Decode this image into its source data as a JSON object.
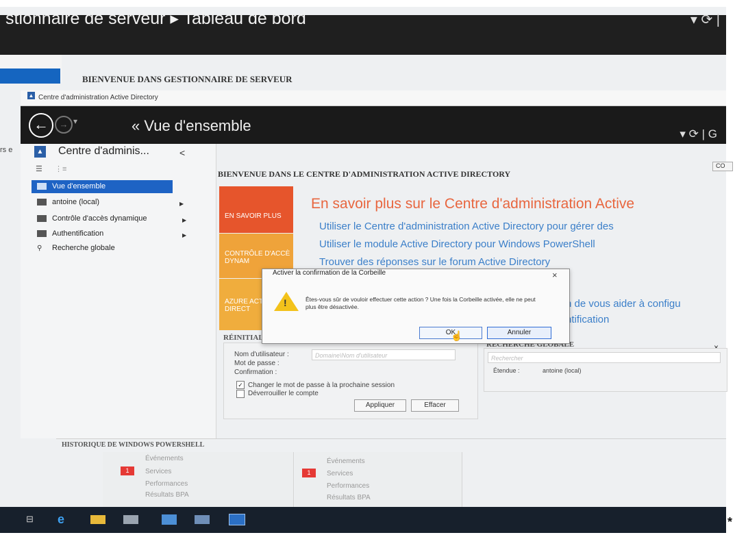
{
  "server_manager": {
    "title": "stionnaire de serveur ▸ Tableau de bord",
    "welcome": "BIENVENUE DANS GESTIONNAIRE DE SERVEUR",
    "refresh_icon": "refresh-icon"
  },
  "adac": {
    "window_title": "Centre d'administration Active Directory",
    "header_title": "« Vue d'ensemble",
    "nav_title": "Centre d'adminis...",
    "nav_collapse": "<",
    "nav_items": [
      {
        "label": "Vue d'ensemble",
        "selected": true
      },
      {
        "label": "antoine (local)",
        "arrow": "▶"
      },
      {
        "label": "Contrôle d'accès dynamique",
        "arrow": "▶"
      },
      {
        "label": "Authentification",
        "arrow": "▶"
      },
      {
        "label": "Recherche globale"
      }
    ],
    "left_fragment": "rs e",
    "main_title": "BIENVENUE DANS LE CENTRE D'ADMINISTRATION ACTIVE DIRECTORY",
    "top_button": "CO",
    "tiles": [
      {
        "label": "EN SAVOIR PLUS"
      },
      {
        "label": "CONTRÔLE D'ACCÈ DYNAM"
      },
      {
        "label": "AZURE ACTIVE DIRECT"
      }
    ],
    "learn": {
      "title": "En savoir plus sur le Centre d'administration Active",
      "links": [
        "Utiliser le Centre d'administration Active Directory pour gérer des",
        "Utiliser le module Active Directory pour Windows PowerShell",
        "Trouver des réponses sur le forum Active Directory"
      ],
      "fragment1": "n de vous aider à configu",
      "fragment2": "ntification"
    },
    "reset": {
      "title": "RÉINITIALISER LE MOT DE PASSE",
      "user_label": "Nom d'utilisateur :",
      "user_placeholder": "Domaine\\Nom d'utilisateur",
      "password_label": "Mot de passe :",
      "confirm_label": "Confirmation :",
      "change_label": "Changer le mot de passe à la prochaine session",
      "unlock_label": "Déverrouiller le compte",
      "apply": "Appliquer",
      "clear": "Effacer"
    },
    "global_search": {
      "title": "RECHERCHE GLOBALE",
      "close": "×",
      "placeholder": "Rechercher",
      "scope_label": "Étendue :",
      "scope_value": "antoine (local)"
    },
    "powershell_title": "HISTORIQUE DE WINDOWS POWERSHELL"
  },
  "dialog": {
    "title": "Activer la confirmation de la Corbeille",
    "close": "×",
    "message": "Êtes-vous sûr de vouloir effectuer cette action ? Une fois la Corbeille activée, elle ne peut plus être désactivée.",
    "ok": "OK",
    "cancel": "Annuler"
  },
  "status_panels": [
    {
      "items": [
        "Événements",
        "Services",
        "Performances",
        "Résultats BPA"
      ],
      "badge": "1"
    },
    {
      "items": [
        "Événements",
        "Services",
        "Performances",
        "Résultats BPA"
      ],
      "badge": "1"
    }
  ],
  "taskbar": {
    "icons": [
      "task-view-icon",
      "ie-icon",
      "folder-icon",
      "server-manager-icon",
      "explorer-icon",
      "network-icon",
      "adac-icon"
    ]
  },
  "corner_mark": "*",
  "colors": {
    "accent": "#1e63c4",
    "orange": "#e6552c",
    "link": "#3b7fc9"
  }
}
